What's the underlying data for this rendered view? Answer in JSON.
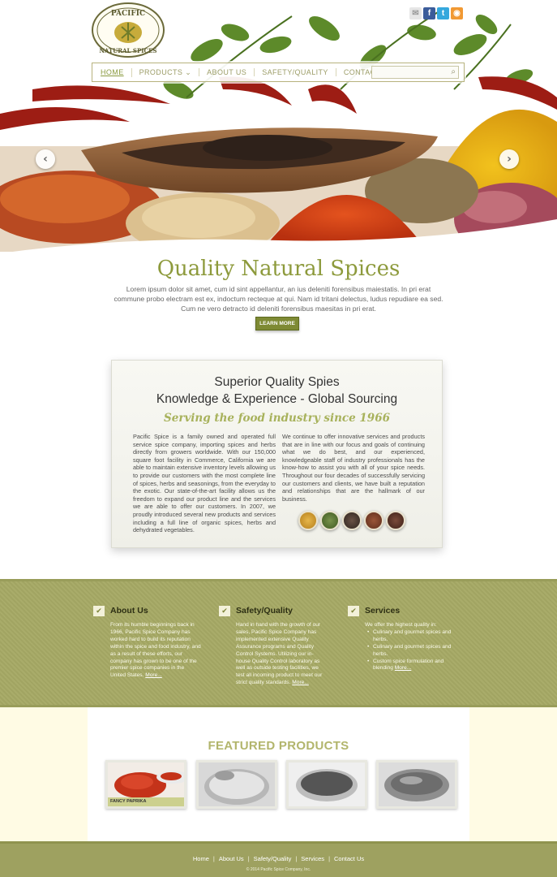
{
  "brand": {
    "logo_line1": "PACIFIC",
    "logo_line2": "NATURAL SPICES"
  },
  "social": [
    {
      "name": "email",
      "glyph": "✉"
    },
    {
      "name": "facebook",
      "glyph": "f"
    },
    {
      "name": "twitter",
      "glyph": "t"
    },
    {
      "name": "rss",
      "glyph": "◉"
    }
  ],
  "nav": {
    "items": [
      "HOME",
      "PRODUCTS",
      "ABOUT US",
      "SAFETY/QUALITY",
      "CONTACT US"
    ],
    "search_placeholder": ""
  },
  "hero": {
    "title": "Quality Natural Spices",
    "text": "Lorem ipsum dolor sit amet, cum id sint appellantur, an ius deleniti forensibus maiestatis. In pri erat commune probo electram est ex, indoctum recteque at qui. Nam id tritani delectus, ludus repudiare ea sed. Cum ne vero detracto id deleniti forensibus maesitas in pri erat.",
    "button": "LEARN MORE"
  },
  "card": {
    "heading1": "Superior Quality Spies",
    "heading2": "Knowledge & Experience - Global Sourcing",
    "tagline": "Serving the food industry since 1966",
    "col_left": "Pacific Spice is a family owned and operated full service spice company, importing spices and herbs directly from growers worldwide. With our 150,000 square foot facility in Commerce, California we are able to maintain extensive inventory levels allowing us to provide our customers with the most complete line of spices, herbs and seasonings, from the everyday to the exotic. Our state-of-the-art facility allows us the freedom to expand our product line and the services we are able to offer our customers. In 2007, we proudly introduced several new products and services including a full line of organic spices, herbs and dehydrated vegetables.",
    "col_right": "We continue to offer innovative services and products that are in line with our focus and goals of continuing what we do best, and our experienced, knowledgeable staff of industry professionals has the know-how to assist you with all of your spice needs. Throughout our four decades of successfully servicing our customers and clients, we have built a reputation and relationships that are the hallmark of our business."
  },
  "features": [
    {
      "title": "About Us",
      "body": "From its humble beginnings back in 1966, Pacific Spice Company has worked hard to build its reputation within the spice and food industry, and as a result of these efforts, our company has grown to be one of the premier spice companies in the United States.",
      "more": "More..."
    },
    {
      "title": "Safety/Quality",
      "body": "Hand in hand with the growth of our sales, Pacific Spice Company has implemented extensive Quality Assurance programs and Quality Control Systems. Utilizing our in-house Quality Control laboratory as well as outside testing facilities, we test all incoming product to meet our strict quality standards.",
      "more": "More..."
    },
    {
      "title": "Services",
      "intro": "We offer the highest quality in:",
      "list": [
        "Culinary and gourmet spices and herbs.",
        "Culinary and gourmet spices and herbs.",
        "Custom spice formulation and blending"
      ],
      "more": "More..."
    }
  ],
  "featured": {
    "title": "FEATURED PRODUCTS",
    "products": [
      {
        "label": "FANCY PAPRIKA"
      },
      {
        "label": ""
      },
      {
        "label": ""
      },
      {
        "label": ""
      }
    ]
  },
  "footer": {
    "links": [
      "Home",
      "About Us",
      "Safety/Quality",
      "Services",
      "Contact Us"
    ],
    "copyright": "© 2014 Pacific Spice Company, Inc."
  },
  "colors": {
    "accent": "#8d9a3c",
    "band": "#a6a965",
    "button": "#7e8a34",
    "footer": "#9ea160"
  }
}
